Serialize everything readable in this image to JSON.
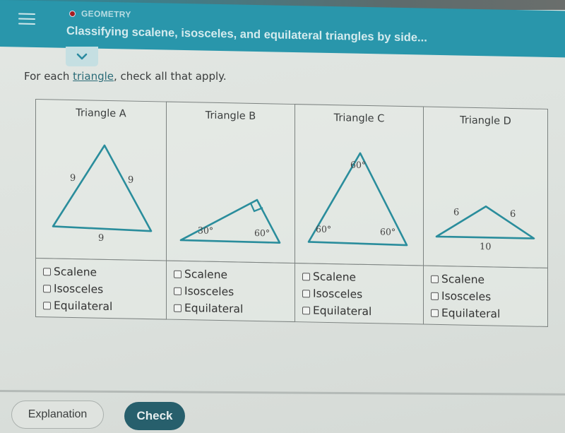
{
  "header": {
    "menu_icon": "hamburger-menu-icon",
    "topic_status_color": "#a41d20",
    "topic": "GEOMETRY",
    "lesson_title": "Classifying scalene, isosceles, and equilateral triangles by side...",
    "expand_icon": "chevron-down-icon"
  },
  "prompt": {
    "before": "For each ",
    "link": "triangle",
    "after": ", check all that apply."
  },
  "triangles": [
    {
      "title": "Triangle A",
      "labels": [
        "9",
        "9",
        "9"
      ],
      "options": [
        {
          "label": "Scalene",
          "checked": false
        },
        {
          "label": "Isosceles",
          "checked": false
        },
        {
          "label": "Equilateral",
          "checked": false
        }
      ]
    },
    {
      "title": "Triangle B",
      "labels": [
        "30°",
        "60°"
      ],
      "options": [
        {
          "label": "Scalene",
          "checked": false
        },
        {
          "label": "Isosceles",
          "checked": false
        },
        {
          "label": "Equilateral",
          "checked": false
        }
      ]
    },
    {
      "title": "Triangle C",
      "labels": [
        "60°",
        "60°",
        "60°"
      ],
      "options": [
        {
          "label": "Scalene",
          "checked": false
        },
        {
          "label": "Isosceles",
          "checked": false
        },
        {
          "label": "Equilateral",
          "checked": false
        }
      ]
    },
    {
      "title": "Triangle D",
      "labels": [
        "6",
        "6",
        "10"
      ],
      "options": [
        {
          "label": "Scalene",
          "checked": false
        },
        {
          "label": "Isosceles",
          "checked": false
        },
        {
          "label": "Equilateral",
          "checked": false
        }
      ]
    }
  ],
  "colors": {
    "header_bg": "#2996ab",
    "triangle_stroke": "#2a8d9c",
    "check_button_bg": "#275f6c"
  },
  "footer": {
    "explanation_label": "Explanation",
    "check_label": "Check"
  }
}
